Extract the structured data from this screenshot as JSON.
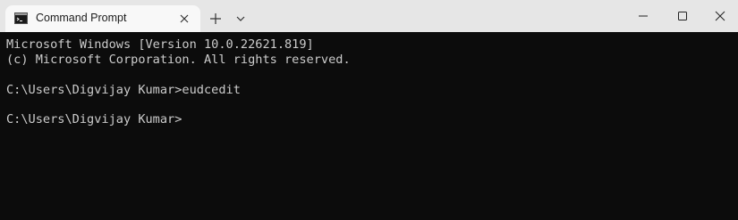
{
  "titlebar": {
    "tab_title": "Command Prompt"
  },
  "terminal": {
    "lines": [
      "Microsoft Windows [Version 10.0.22621.819]",
      "(c) Microsoft Corporation. All rights reserved.",
      "",
      "C:\\Users\\Digvijay Kumar>eudcedit",
      "",
      "C:\\Users\\Digvijay Kumar>"
    ]
  },
  "colors": {
    "titlebar_bg": "#e6e6e6",
    "tab_bg": "#f8f8f8",
    "terminal_bg": "#0c0c0c",
    "terminal_text": "#cccccc"
  }
}
